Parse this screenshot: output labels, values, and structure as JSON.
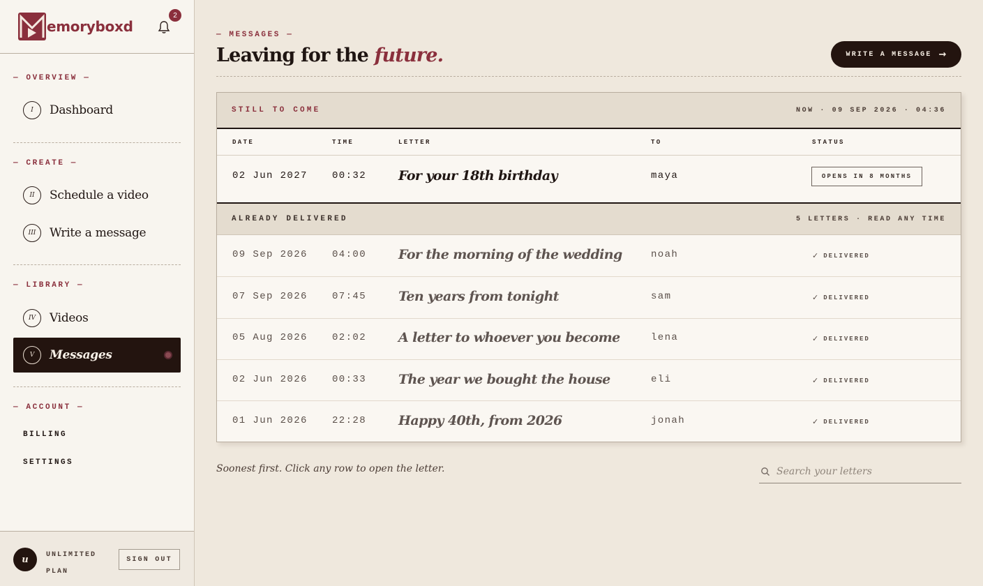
{
  "brand": {
    "name": "emoryboxd",
    "notification_count": "2"
  },
  "sidebar": {
    "sections": [
      {
        "label": "— OVERVIEW —"
      },
      {
        "label": "— CREATE —"
      },
      {
        "label": "— LIBRARY —"
      },
      {
        "label": "— ACCOUNT —"
      }
    ],
    "items": [
      {
        "numeral": "I",
        "label": "Dashboard"
      },
      {
        "numeral": "II",
        "label": "Schedule a video"
      },
      {
        "numeral": "III",
        "label": "Write a message"
      },
      {
        "numeral": "IV",
        "label": "Videos"
      },
      {
        "numeral": "V",
        "label": "Messages"
      }
    ],
    "account_links": [
      "BILLING",
      "SETTINGS"
    ],
    "footer": {
      "avatar": "u",
      "plan_line1": "UNLIMITED",
      "plan_line2": "PLAN",
      "sign_out": "SIGN OUT"
    }
  },
  "header": {
    "eyebrow": "— MESSAGES —",
    "title_prefix": "Leaving for the ",
    "title_emph": "future.",
    "write_button": "WRITE A MESSAGE",
    "write_arrow": "→"
  },
  "table": {
    "upcoming_band": {
      "label": "STILL TO COME",
      "meta": "NOW · 09 SEP 2026 · 04:36"
    },
    "columns": [
      "DATE",
      "TIME",
      "LETTER",
      "TO",
      "STATUS"
    ],
    "upcoming": [
      {
        "date": "02 Jun 2027",
        "time": "00:32",
        "letter": "For your 18th birthday",
        "to": "maya",
        "status": "OPENS IN 8 MONTHS"
      }
    ],
    "delivered_band": {
      "label": "ALREADY DELIVERED",
      "meta": "5 LETTERS · READ ANY TIME"
    },
    "delivered": [
      {
        "date": "09 Sep 2026",
        "time": "04:00",
        "letter": "For the morning of the wedding",
        "to": "noah",
        "status": "DELIVERED"
      },
      {
        "date": "07 Sep 2026",
        "time": "07:45",
        "letter": "Ten years from tonight",
        "to": "sam",
        "status": "DELIVERED"
      },
      {
        "date": "05 Aug 2026",
        "time": "02:02",
        "letter": "A letter to whoever you become",
        "to": "lena",
        "status": "DELIVERED"
      },
      {
        "date": "02 Jun 2026",
        "time": "00:33",
        "letter": "The year we bought the house",
        "to": "eli",
        "status": "DELIVERED"
      },
      {
        "date": "01 Jun 2026",
        "time": "22:28",
        "letter": "Happy 40th, from 2026",
        "to": "jonah",
        "status": "DELIVERED"
      }
    ],
    "check_icon": "✓"
  },
  "footer": {
    "note": "Soonest first. Click any row to open the letter.",
    "search_placeholder": "Search your letters"
  },
  "colors": {
    "accent": "#8a2f3c",
    "ink": "#23140f",
    "paper": "#efe8dd"
  }
}
